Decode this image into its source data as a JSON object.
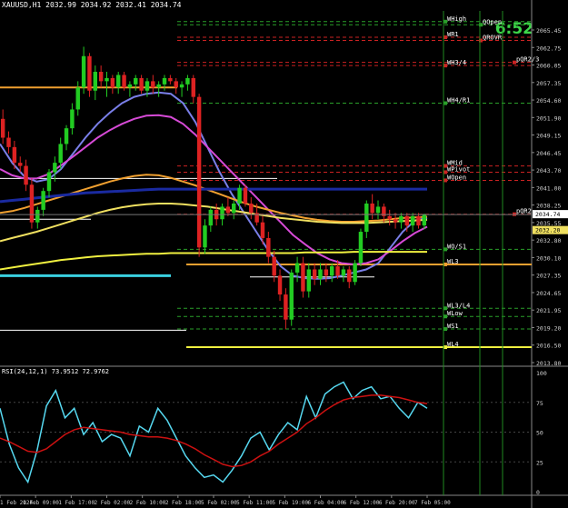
{
  "header": {
    "text": "XAUUSD,H1  2032.99 2034.92 2032.41 2034.74"
  },
  "timer": "6:52",
  "colors": {
    "background": "#000000",
    "bull": "#22cc22",
    "bear": "#dd2222",
    "price_axis_text": "#cfcfcf"
  },
  "chart_data": [
    {
      "type": "line",
      "name": "price",
      "ylim": [
        2011.0,
        2067.5
      ],
      "x_tick_labels": [
        "1 Feb 2024",
        "1 Feb 09:00",
        "1 Feb 17:00",
        "2 Feb 02:00",
        "2 Feb 10:00",
        "2 Feb 18:00",
        "5 Feb 02:00",
        "5 Feb 11:00",
        "5 Feb 19:00",
        "6 Feb 04:00",
        "6 Feb 12:00",
        "6 Feb 20:00",
        "7 Feb 05:00"
      ],
      "y_tick_labels": [
        "2065.45",
        "2062.75",
        "2060.05",
        "2057.35",
        "2054.60",
        "2051.90",
        "2049.15",
        "2046.45",
        "2043.70",
        "2041.00",
        "2038.25",
        "2035.55",
        "2032.80",
        "2030.10",
        "2027.35",
        "2024.65",
        "2021.95",
        "2019.20",
        "2016.50",
        "2013.80"
      ],
      "current_price": "2034.74",
      "current_price_2": "2032.20",
      "candles": [
        [
          2050.0,
          2051.5,
          2046.0,
          2047.0
        ],
        [
          2047.0,
          2048.0,
          2044.5,
          2045.5
        ],
        [
          2045.5,
          2046.5,
          2042.0,
          2043.0
        ],
        [
          2043.0,
          2044.0,
          2041.5,
          2042.5
        ],
        [
          2042.5,
          2043.5,
          2038.5,
          2039.5
        ],
        [
          2039.5,
          2040.5,
          2032.5,
          2033.5
        ],
        [
          2033.5,
          2036.0,
          2032.5,
          2035.5
        ],
        [
          2035.5,
          2039.0,
          2034.5,
          2038.5
        ],
        [
          2038.5,
          2042.0,
          2037.5,
          2041.5
        ],
        [
          2041.5,
          2044.0,
          2040.0,
          2043.0
        ],
        [
          2043.0,
          2047.0,
          2042.0,
          2046.0
        ],
        [
          2046.0,
          2049.0,
          2045.0,
          2048.5
        ],
        [
          2048.5,
          2052.5,
          2047.5,
          2051.5
        ],
        [
          2051.5,
          2056.0,
          2050.5,
          2055.0
        ],
        [
          2055.0,
          2061.5,
          2054.0,
          2060.0
        ],
        [
          2060.0,
          2060.5,
          2053.5,
          2054.5
        ],
        [
          2054.5,
          2058.5,
          2053.0,
          2057.5
        ],
        [
          2057.5,
          2058.5,
          2055.0,
          2056.0
        ],
        [
          2056.0,
          2057.5,
          2053.5,
          2056.5
        ],
        [
          2056.5,
          2057.0,
          2054.0,
          2055.0
        ],
        [
          2055.0,
          2057.5,
          2054.0,
          2057.0
        ],
        [
          2057.0,
          2057.5,
          2054.5,
          2055.0
        ],
        [
          2055.0,
          2056.0,
          2053.5,
          2055.5
        ],
        [
          2055.5,
          2057.0,
          2054.5,
          2056.5
        ],
        [
          2056.5,
          2057.0,
          2054.0,
          2054.5
        ],
        [
          2054.5,
          2056.5,
          2053.5,
          2056.0
        ],
        [
          2056.0,
          2057.0,
          2054.0,
          2055.0
        ],
        [
          2055.0,
          2056.0,
          2053.5,
          2055.5
        ],
        [
          2055.5,
          2057.0,
          2054.5,
          2056.5
        ],
        [
          2056.5,
          2057.0,
          2055.5,
          2056.0
        ],
        [
          2056.0,
          2056.5,
          2054.0,
          2055.0
        ],
        [
          2055.0,
          2056.0,
          2053.5,
          2055.5
        ],
        [
          2055.5,
          2057.0,
          2054.5,
          2056.5
        ],
        [
          2056.5,
          2057.0,
          2052.5,
          2053.5
        ],
        [
          2053.5,
          2054.0,
          2028.0,
          2029.5
        ],
        [
          2029.5,
          2034.0,
          2028.5,
          2033.0
        ],
        [
          2033.0,
          2036.0,
          2032.0,
          2035.5
        ],
        [
          2035.5,
          2036.5,
          2033.0,
          2034.0
        ],
        [
          2034.0,
          2036.5,
          2033.0,
          2036.0
        ],
        [
          2036.0,
          2037.5,
          2034.5,
          2035.0
        ],
        [
          2035.0,
          2037.0,
          2034.0,
          2036.5
        ],
        [
          2036.5,
          2039.5,
          2035.5,
          2039.0
        ],
        [
          2039.0,
          2039.5,
          2036.0,
          2036.5
        ],
        [
          2036.5,
          2037.5,
          2034.0,
          2035.0
        ],
        [
          2035.0,
          2036.5,
          2033.0,
          2033.5
        ],
        [
          2033.5,
          2034.5,
          2030.0,
          2031.0
        ],
        [
          2031.0,
          2032.0,
          2027.0,
          2028.0
        ],
        [
          2028.0,
          2029.0,
          2024.0,
          2025.0
        ],
        [
          2025.0,
          2026.0,
          2021.0,
          2022.0
        ],
        [
          2022.0,
          2023.0,
          2016.5,
          2018.0
        ],
        [
          2018.0,
          2026.0,
          2017.0,
          2025.5
        ],
        [
          2025.5,
          2028.0,
          2024.0,
          2027.0
        ],
        [
          2027.0,
          2028.0,
          2021.5,
          2022.5
        ],
        [
          2022.5,
          2027.0,
          2021.5,
          2026.0
        ],
        [
          2026.0,
          2027.0,
          2023.5,
          2024.5
        ],
        [
          2024.5,
          2027.0,
          2023.5,
          2026.0
        ],
        [
          2026.0,
          2027.0,
          2024.0,
          2025.0
        ],
        [
          2025.0,
          2027.0,
          2024.0,
          2026.5
        ],
        [
          2026.5,
          2027.5,
          2024.5,
          2025.0
        ],
        [
          2025.0,
          2026.5,
          2024.0,
          2026.0
        ],
        [
          2026.0,
          2026.5,
          2023.0,
          2024.0
        ],
        [
          2024.0,
          2027.5,
          2023.5,
          2027.0
        ],
        [
          2027.0,
          2032.5,
          2026.5,
          2032.0
        ],
        [
          2032.0,
          2037.0,
          2031.0,
          2036.5
        ],
        [
          2036.5,
          2038.0,
          2034.0,
          2035.0
        ],
        [
          2035.0,
          2037.0,
          2034.0,
          2036.0
        ],
        [
          2036.0,
          2036.5,
          2033.5,
          2034.5
        ],
        [
          2034.5,
          2035.5,
          2033.0,
          2034.0
        ],
        [
          2034.0,
          2035.0,
          2032.5,
          2033.5
        ],
        [
          2033.5,
          2035.0,
          2032.5,
          2034.5
        ],
        [
          2034.5,
          2035.0,
          2032.0,
          2033.0
        ],
        [
          2033.0,
          2035.0,
          2032.0,
          2034.5
        ],
        [
          2034.5,
          2035.0,
          2032.5,
          2033.0
        ],
        [
          2033.0,
          2034.9,
          2032.4,
          2034.7
        ]
      ],
      "lines": [
        {
          "label": "WHigh",
          "value": 2065.5
        },
        {
          "label": "WR1",
          "value": 2063.0
        },
        {
          "label": "QOpen",
          "value": 2065.0
        },
        {
          "label": "QROVR",
          "value": 2062.5
        },
        {
          "label": "pQR2/3",
          "value": 2059.0
        },
        {
          "label": "WH3/4",
          "value": 2058.5
        },
        {
          "label": "WH4/R1",
          "value": 2052.5
        },
        {
          "label": "WMid",
          "value": 2042.5
        },
        {
          "label": "WPivot",
          "value": 2041.5
        },
        {
          "label": "WOpen",
          "value": 2040.2
        },
        {
          "label": "pQR2",
          "value": 2034.8
        },
        {
          "label": "WO/S1",
          "value": 2029.2
        },
        {
          "label": "WL3",
          "value": 2026.8
        },
        {
          "label": "WL3/L4",
          "value": 2019.8
        },
        {
          "label": "WLow",
          "value": 2018.5
        },
        {
          "label": "WS1",
          "value": 2016.5
        },
        {
          "label": "WL4",
          "value": 2013.6
        }
      ],
      "ma": [
        {
          "name": "MA blue-violet",
          "color": "#7a7fe8",
          "values": [
            2046.0,
            2043.0,
            2040.8,
            2040.0,
            2040.4,
            2042.0,
            2044.5,
            2047.0,
            2049.2,
            2051.0,
            2052.5,
            2053.5,
            2054.0,
            2054.2,
            2054.0,
            2052.5,
            2049.5,
            2045.5,
            2041.5,
            2038.0,
            2035.0,
            2032.0,
            2029.0,
            2026.5,
            2025.0,
            2024.6,
            2024.5,
            2024.6,
            2025.0,
            2025.5,
            2026.0,
            2027.0,
            2029.5,
            2032.0,
            2033.8,
            2034.2
          ]
        },
        {
          "name": "MA magenta",
          "color": "#d64ad6",
          "values": [
            2042.0,
            2041.0,
            2040.5,
            2040.5,
            2041.2,
            2042.6,
            2044.0,
            2045.5,
            2047.0,
            2048.2,
            2049.2,
            2050.0,
            2050.5,
            2050.6,
            2050.3,
            2049.2,
            2047.5,
            2045.5,
            2043.5,
            2041.5,
            2039.5,
            2037.5,
            2035.5,
            2033.5,
            2031.5,
            2030.0,
            2028.6,
            2027.6,
            2027.0,
            2026.8,
            2027.0,
            2027.6,
            2029.0,
            2030.5,
            2031.8,
            2032.8
          ]
        },
        {
          "name": "MA orange",
          "color": "#f0a030",
          "values": [
            2035.0,
            2035.3,
            2035.8,
            2036.4,
            2037.0,
            2037.6,
            2038.2,
            2038.8,
            2039.4,
            2040.0,
            2040.5,
            2040.9,
            2041.1,
            2041.0,
            2040.6,
            2040.0,
            2039.4,
            2038.7,
            2038.0,
            2037.3,
            2036.6,
            2036.0,
            2035.5,
            2035.0,
            2034.6,
            2034.2,
            2033.9,
            2033.7,
            2033.6,
            2033.6,
            2033.7,
            2033.8,
            2034.0,
            2034.2,
            2034.3,
            2034.4
          ]
        },
        {
          "name": "MA yellow",
          "color": "#f0e060",
          "values": [
            2030.5,
            2031.0,
            2031.5,
            2032.0,
            2032.6,
            2033.2,
            2033.8,
            2034.4,
            2035.0,
            2035.5,
            2035.9,
            2036.2,
            2036.4,
            2036.5,
            2036.5,
            2036.4,
            2036.2,
            2036.0,
            2035.7,
            2035.4,
            2035.1,
            2034.8,
            2034.5,
            2034.2,
            2034.0,
            2033.8,
            2033.6,
            2033.5,
            2033.4,
            2033.4,
            2033.4,
            2033.5,
            2033.6,
            2033.7,
            2033.8,
            2033.9
          ]
        },
        {
          "name": "MA navy",
          "color": "#1a2aa0",
          "values": [
            2036.8,
            2037.0,
            2037.2,
            2037.4,
            2037.6,
            2037.8,
            2038.0,
            2038.2,
            2038.3,
            2038.4,
            2038.5,
            2038.6,
            2038.7,
            2038.8,
            2038.8,
            2038.8,
            2038.8,
            2038.8,
            2038.8,
            2038.8,
            2038.8,
            2038.8,
            2038.8,
            2038.8,
            2038.8,
            2038.8,
            2038.8,
            2038.8,
            2038.8,
            2038.8,
            2038.8,
            2038.8,
            2038.8,
            2038.8,
            2038.8,
            2038.8
          ]
        },
        {
          "name": "MA yellow long",
          "color": "#f0f040",
          "values": [
            2026.0,
            2026.3,
            2026.6,
            2026.9,
            2027.2,
            2027.5,
            2027.7,
            2027.9,
            2028.1,
            2028.2,
            2028.3,
            2028.4,
            2028.5,
            2028.5,
            2028.6,
            2028.6,
            2028.6,
            2028.6,
            2028.6,
            2028.6,
            2028.6,
            2028.6,
            2028.6,
            2028.6,
            2028.6,
            2028.7,
            2028.7,
            2028.7,
            2028.7,
            2028.8,
            2028.8,
            2028.8,
            2028.8,
            2028.8,
            2028.8,
            2028.8
          ]
        }
      ]
    },
    {
      "type": "line",
      "name": "RSI",
      "header": "RSI(24,12,1) 73.9512 72.9762",
      "ylim": [
        0,
        100
      ],
      "y_tick_labels": [
        "100",
        "75",
        "50",
        "25",
        "0"
      ],
      "series": [
        {
          "name": "fast",
          "color": "#56d8f0",
          "values": [
            70,
            40,
            20,
            8,
            35,
            72,
            85,
            62,
            70,
            48,
            58,
            42,
            48,
            45,
            30,
            55,
            50,
            70,
            60,
            45,
            30,
            20,
            12,
            14,
            8,
            18,
            30,
            45,
            50,
            35,
            48,
            58,
            52,
            80,
            62,
            82,
            88,
            92,
            78,
            85,
            88,
            78,
            80,
            70,
            62,
            75,
            70
          ]
        },
        {
          "name": "slow",
          "color": "#cc1111",
          "values": [
            45,
            42,
            38,
            34,
            33,
            36,
            42,
            48,
            52,
            54,
            53,
            52,
            51,
            50,
            48,
            47,
            46,
            46,
            45,
            43,
            40,
            36,
            31,
            27,
            23,
            21,
            22,
            25,
            30,
            34,
            40,
            45,
            50,
            57,
            62,
            68,
            73,
            77,
            79,
            80,
            81,
            81,
            80,
            79,
            77,
            75,
            74
          ]
        }
      ]
    }
  ]
}
